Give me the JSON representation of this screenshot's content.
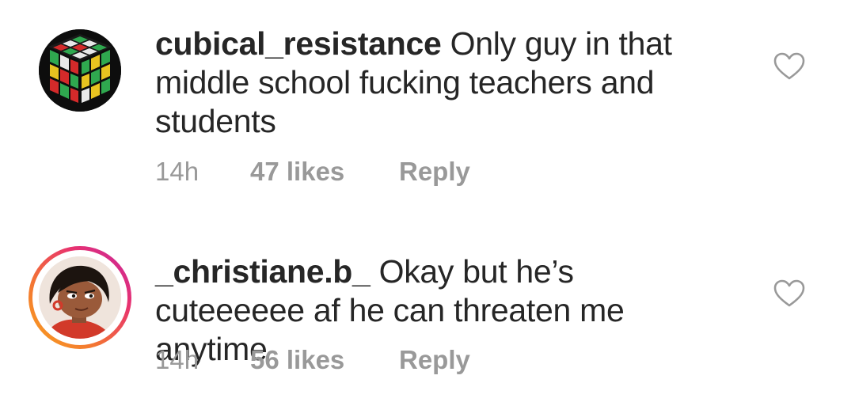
{
  "comments": [
    {
      "username": "cubical_resistance",
      "text": "Only guy in that middle school fucking teachers and students",
      "time": "14h",
      "likes": "47 likes",
      "reply": "Reply",
      "avatar_icon": "rubiks-cube-avatar",
      "like_icon": "heart-outline-icon"
    },
    {
      "username": "_christiane.b_",
      "text": "Okay but he’s cuteeeeee af he can threaten me anytime",
      "time": "14h",
      "likes": "56 likes",
      "reply": "Reply",
      "avatar_icon": "cartoon-girl-avatar",
      "has_story_ring": true,
      "like_icon": "heart-outline-icon"
    }
  ],
  "colors": {
    "text": "#262626",
    "meta": "#999999",
    "story_ring_start": "#f9a51c",
    "story_ring_end": "#c326a3"
  }
}
